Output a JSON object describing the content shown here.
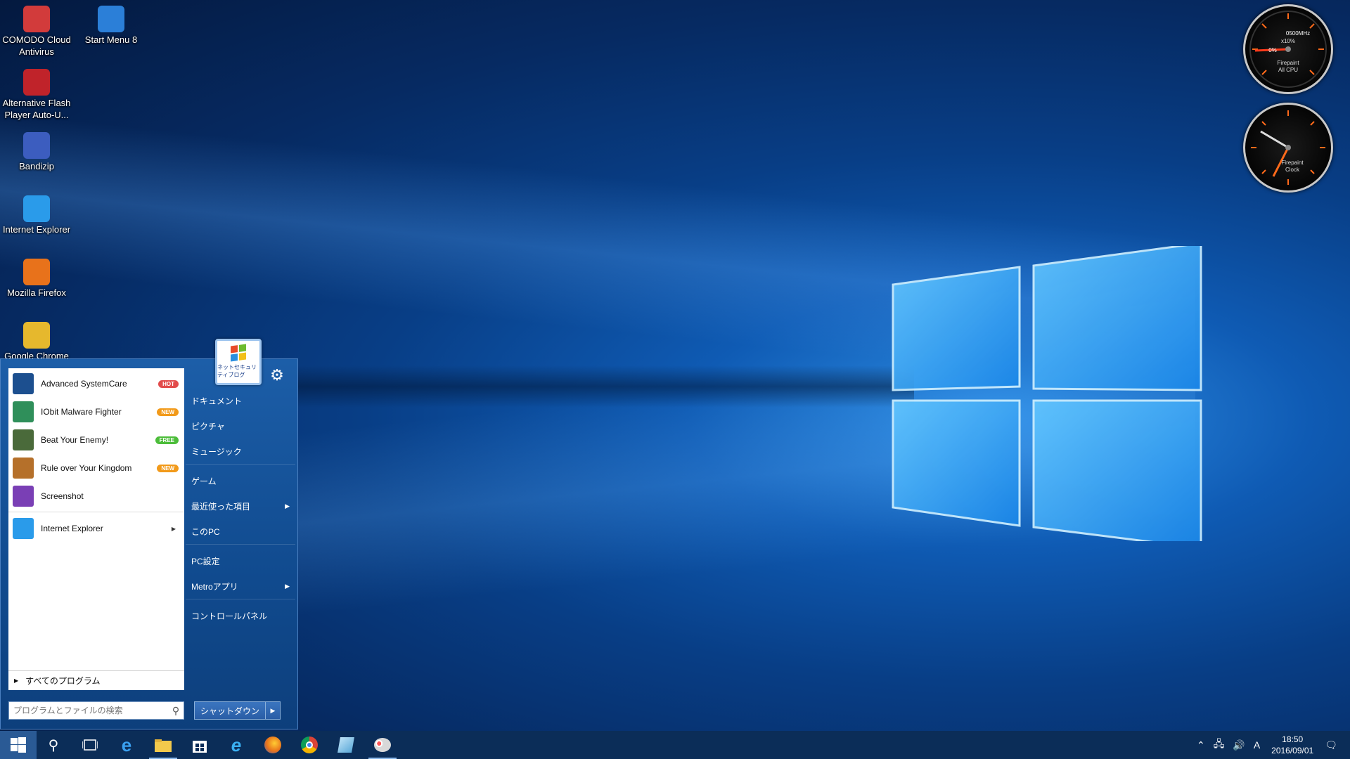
{
  "desktop": {
    "icons": [
      {
        "label": "COMODO Cloud\nAntivirus",
        "icon": "comodo-icon",
        "color": "#d23b3b"
      },
      {
        "label": "Start Menu 8",
        "icon": "start-menu-8-icon",
        "color": "#2b7fd8"
      },
      {
        "label": "Alternative Flash\nPlayer Auto-U...",
        "icon": "flash-icon",
        "color": "#c0232a"
      },
      {
        "label": "Bandizip",
        "icon": "bandizip-icon",
        "color": "#3c5dbf"
      },
      {
        "label": "Internet Explorer",
        "icon": "internet-explorer-icon",
        "color": "#2a9bea"
      },
      {
        "label": "Mozilla Firefox",
        "icon": "firefox-icon",
        "color": "#e8721b"
      },
      {
        "label": "Google Chrome",
        "icon": "chrome-icon",
        "color": "#e6b82d"
      }
    ]
  },
  "gadgets": {
    "cpu": {
      "line1": "0500MHz",
      "line2": "x10%",
      "line3": "0%",
      "line4": "Firepaint",
      "line5": "All CPU"
    },
    "clock": {
      "line1": "Firepaint",
      "line2": "Clock"
    }
  },
  "start_menu": {
    "user_pic_caption": "ネットセキュリティブログ",
    "pinned": [
      {
        "label": "Advanced SystemCare",
        "badge": "HOT",
        "icon": "advanced-systemcare-icon",
        "color": "#1c4f8f"
      },
      {
        "label": "IObit Malware Fighter",
        "badge": "NEW",
        "icon": "iobit-malware-fighter-icon",
        "color": "#2f8f5a"
      },
      {
        "label": "Beat Your Enemy!",
        "badge": "FREE",
        "icon": "beat-your-enemy-icon",
        "color": "#4a6a3a"
      },
      {
        "label": "Rule over Your Kingdom",
        "badge": "NEW",
        "icon": "rule-over-kingdom-icon",
        "color": "#b5702a"
      },
      {
        "label": "Screenshot",
        "badge": "",
        "icon": "screenshot-icon",
        "color": "#7a3fb5"
      },
      {
        "label": "Internet Explorer",
        "badge": "",
        "icon": "internet-explorer-icon",
        "color": "#2a9bea"
      }
    ],
    "all_programs": "すべてのプログラム",
    "search_placeholder": "プログラムとファイルの検索",
    "right_items": [
      {
        "label": "ドキュメント",
        "submenu": false
      },
      {
        "label": "ピクチャ",
        "submenu": false
      },
      {
        "label": "ミュージック",
        "submenu": false
      },
      {
        "label": "ゲーム",
        "submenu": false
      },
      {
        "label": "最近使った項目",
        "submenu": true
      },
      {
        "label": "このPC",
        "submenu": false
      },
      {
        "label": "PC設定",
        "submenu": false
      },
      {
        "label": "Metroアプリ",
        "submenu": true
      },
      {
        "label": "コントロールパネル",
        "submenu": false
      }
    ],
    "shutdown_label": "シャットダウン"
  },
  "taskbar": {
    "time": "18:50",
    "date": "2016/09/01",
    "ime": "A"
  }
}
